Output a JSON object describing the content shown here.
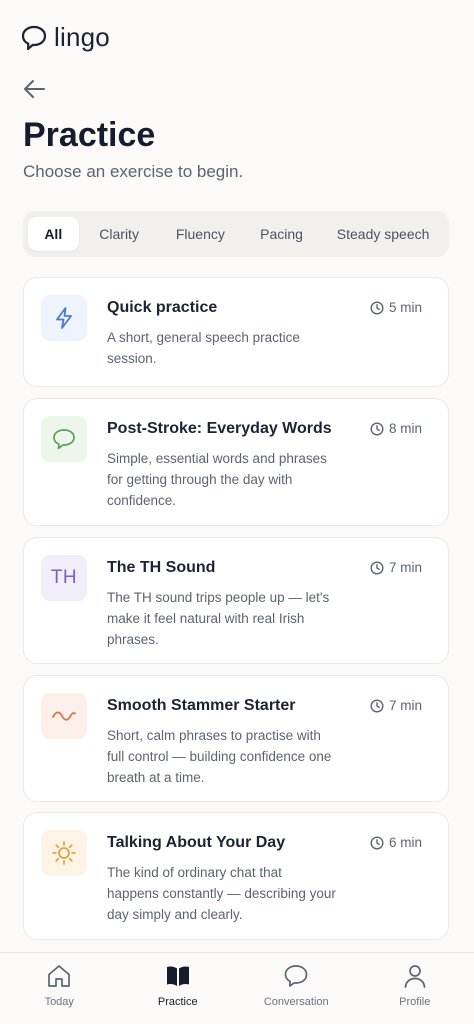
{
  "app": {
    "name": "lingo"
  },
  "page": {
    "title": "Practice",
    "subtitle": "Choose an exercise to begin."
  },
  "filters": {
    "items": [
      {
        "label": "All",
        "active": true
      },
      {
        "label": "Clarity",
        "active": false
      },
      {
        "label": "Fluency",
        "active": false
      },
      {
        "label": "Pacing",
        "active": false
      },
      {
        "label": "Steady speech",
        "active": false
      }
    ]
  },
  "exercises": [
    {
      "title": "Quick practice",
      "description": "A short, general speech practice session.",
      "duration": "5 min",
      "icon": "lightning-icon",
      "icon_color": "#4a7bd4",
      "icon_bg": "#eef3fd"
    },
    {
      "title": "Post-Stroke: Everyday Words",
      "description": "Simple, essential words and phrases for getting through the day with confidence.",
      "duration": "8 min",
      "icon": "speech-bubble-icon",
      "icon_color": "#5aa05c",
      "icon_bg": "#eef6ec"
    },
    {
      "title": "The TH Sound",
      "description": "The TH sound trips people up — let's make it feel natural with real Irish phrases.",
      "duration": "7 min",
      "icon": "TH",
      "icon_color": "#7b63b2",
      "icon_bg": "#f1eefa"
    },
    {
      "title": "Smooth Stammer Starter",
      "description": "Short, calm phrases to practise with full control — building confidence one breath at a time.",
      "duration": "7 min",
      "icon": "wave-icon",
      "icon_color": "#d9744f",
      "icon_bg": "#fdf0ea"
    },
    {
      "title": "Talking About Your Day",
      "description": "The kind of ordinary chat that happens constantly — describing your day simply and clearly.",
      "duration": "6 min",
      "icon": "sun-icon",
      "icon_color": "#e19a2b",
      "icon_bg": "#fdf4e6"
    }
  ],
  "nav": {
    "items": [
      {
        "label": "Today",
        "icon": "home-icon",
        "active": false
      },
      {
        "label": "Practice",
        "icon": "book-icon",
        "active": true
      },
      {
        "label": "Conversation",
        "icon": "chat-icon",
        "active": false
      },
      {
        "label": "Profile",
        "icon": "person-icon",
        "active": false
      }
    ]
  }
}
